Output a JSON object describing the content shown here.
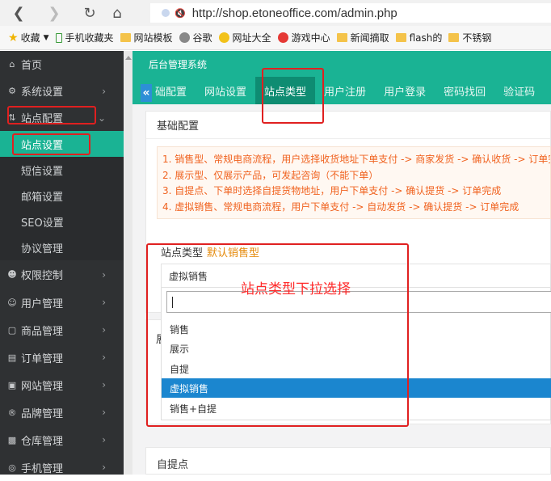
{
  "browser": {
    "url": "http://shop.etoneoffice.com/admin.php",
    "bookmarks": [
      "收藏",
      "手机收藏夹",
      "网站模板",
      "谷歌",
      "网址大全",
      "游戏中心",
      "新闻摘取",
      "flash的",
      "不锈钢"
    ]
  },
  "sidebar": {
    "home": "首页",
    "system": "系统设置",
    "site_config": "站点配置",
    "sub_items": [
      "站点设置",
      "短信设置",
      "邮箱设置",
      "SEO设置",
      "协议管理"
    ],
    "items": [
      "权限控制",
      "用户管理",
      "商品管理",
      "订单管理",
      "网站管理",
      "品牌管理",
      "仓库管理",
      "手机管理"
    ]
  },
  "header": {
    "title": "后台管理系统",
    "tabs": [
      "础配置",
      "网站设置",
      "站点类型",
      "用户注册",
      "用户登录",
      "密码找回",
      "验证码"
    ]
  },
  "panel": {
    "title": "基础配置",
    "notices": [
      "1. 销售型、常规电商流程，用户选择收货地址下单支付 -> 商家发货 -> 确认收货 -> 订单完",
      "2. 展示型、仅展示产品，可发起咨询（不能下单）",
      "3. 自提点、下单时选择自提货物地址，用户下单支付 -> 确认提货 -> 订单完成",
      "4. 虚拟销售、常规电商流程，用户下单支付 -> 自动发货 -> 确认提货 -> 订单完成"
    ],
    "field_label": "站点类型",
    "field_hint": "默认销售型",
    "selected_value": "虚拟销售",
    "options": [
      "销售",
      "展示",
      "自提",
      "虚拟销售",
      "销售+自提"
    ],
    "hidden_label": "展",
    "bottom_title": "自提点"
  },
  "annotation": "站点类型下拉选择",
  "colors": {
    "accent": "#1ab394",
    "selected": "#1b86cf",
    "annotation": "#ff2a2a",
    "notice": "#f0621f"
  }
}
